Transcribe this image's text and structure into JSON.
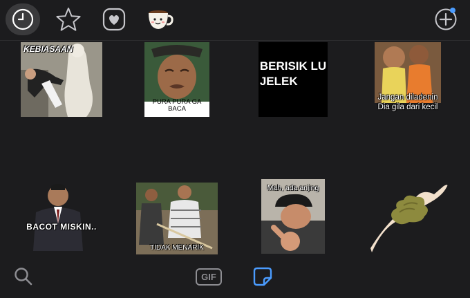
{
  "colors": {
    "background": "#1c1c1e",
    "icon_gray": "#c7c7cc",
    "accent_blue": "#4b9cff"
  },
  "top_tabs": [
    {
      "icon": "clock-icon",
      "active": true
    },
    {
      "icon": "star-icon",
      "active": false
    },
    {
      "icon": "heart-icon",
      "active": false
    },
    {
      "icon": "coffee-cup-icon",
      "active": false
    }
  ],
  "add_button": {
    "icon": "plus-circle-icon",
    "badge": true
  },
  "stickers": [
    {
      "caption": "KEBIASAAN"
    },
    {
      "caption": "PURA PURA GA BACA"
    },
    {
      "caption_line1": "BERISIK LU",
      "caption_line2": "JELEK"
    },
    {
      "caption_line1": "Jangan diladenin",
      "caption_line2": "Dia gila dari kecil"
    },
    {
      "caption": "BACOT MISKIN.."
    },
    {
      "caption": "TIDAK MENARIK"
    },
    {
      "caption": "Mah, ada anjing"
    },
    {
      "caption": ""
    }
  ],
  "bottom_bar": {
    "search_icon": "search-icon",
    "gif_label": "GIF",
    "sticker_icon": "sticker-icon"
  }
}
